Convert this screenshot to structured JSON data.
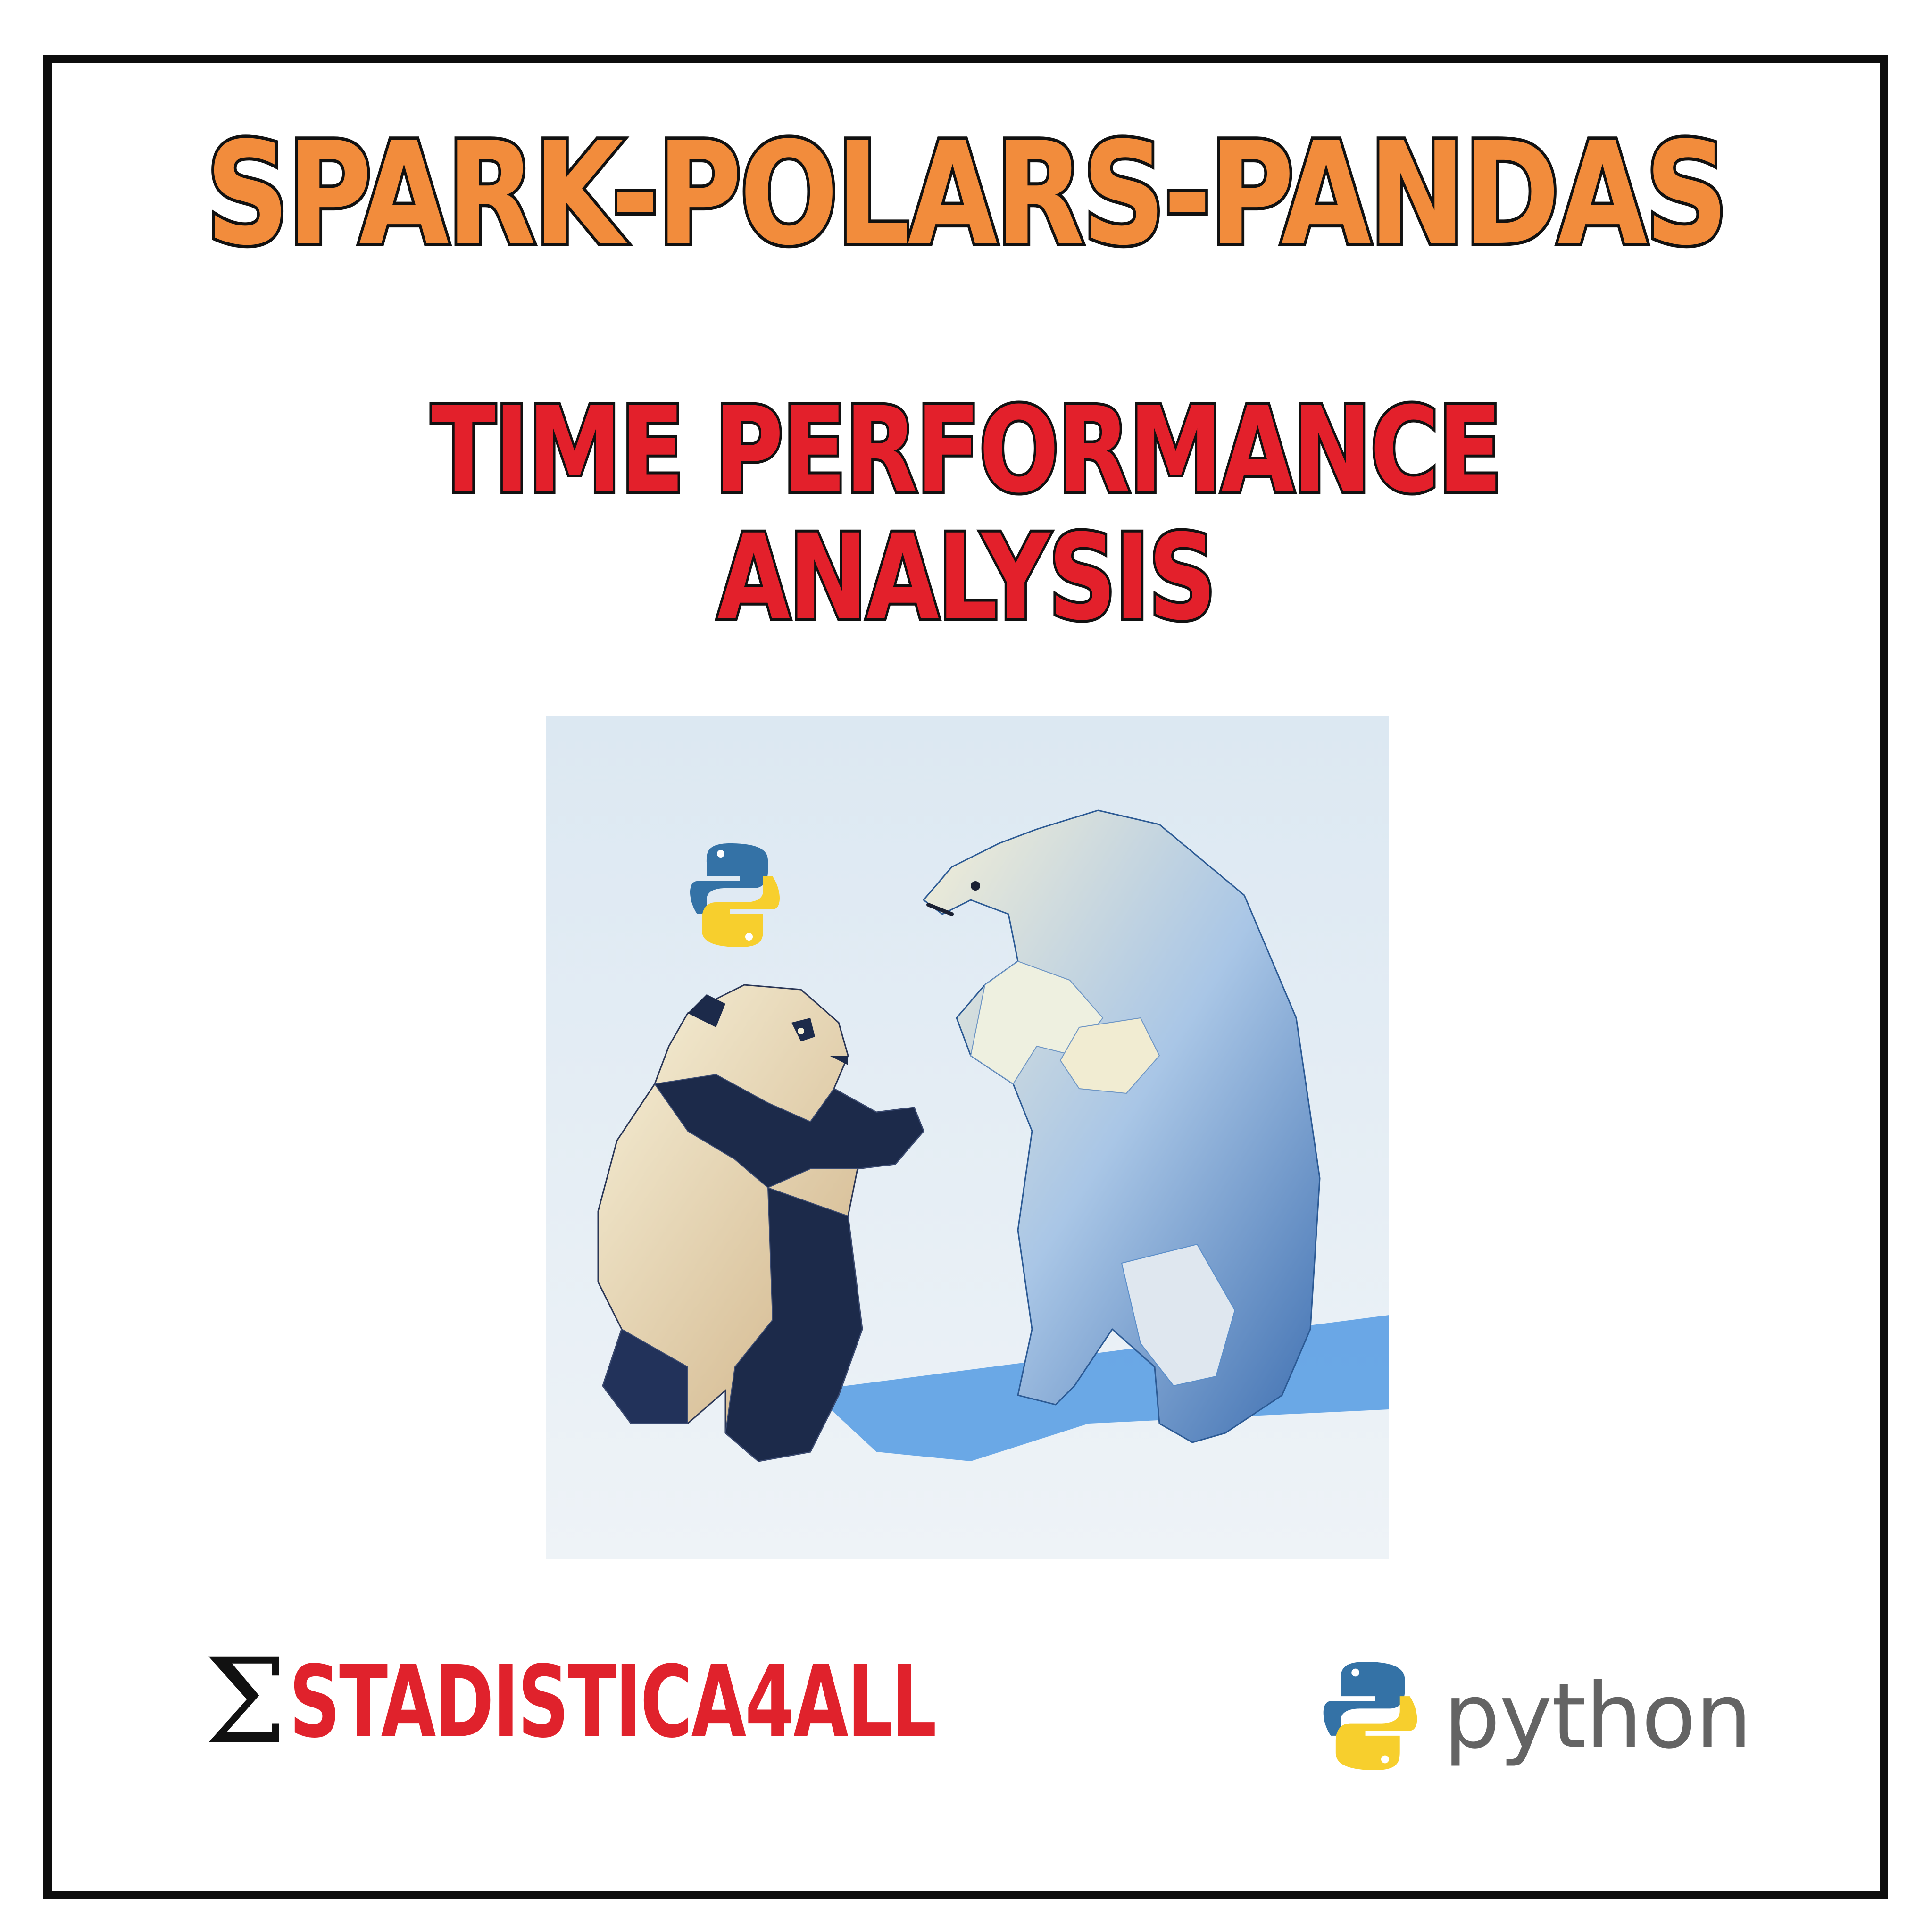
{
  "title": {
    "main": "SPARK-POLARS-PANDAS",
    "sub_line1": "TIME PERFORMANCE",
    "sub_line2": "ANALYSIS"
  },
  "illustration": {
    "icons": [
      "python-logo-icon"
    ],
    "colors": {
      "background": "#e3edf4",
      "panda_dark": "#1c2a4a",
      "bear_blue": "#5b8ec9",
      "cream": "#f4efd6",
      "shadow": "#3f8fe0"
    }
  },
  "footer": {
    "brand_symbol": "Σ",
    "brand_name": "STADISTICA4ALL",
    "python_label": "python"
  },
  "colors": {
    "title_main": "#f28c3c",
    "title_sub": "#e3202b",
    "brand": "#e0222c",
    "border": "#0d0d0d"
  }
}
